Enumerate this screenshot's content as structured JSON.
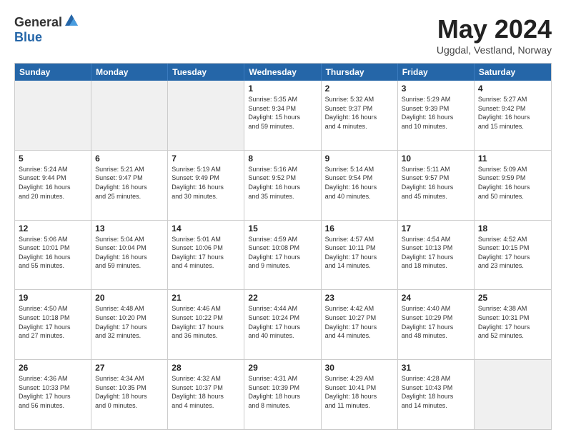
{
  "logo": {
    "general": "General",
    "blue": "Blue"
  },
  "title": "May 2024",
  "subtitle": "Uggdal, Vestland, Norway",
  "days": [
    "Sunday",
    "Monday",
    "Tuesday",
    "Wednesday",
    "Thursday",
    "Friday",
    "Saturday"
  ],
  "rows": [
    [
      {
        "day": "",
        "lines": []
      },
      {
        "day": "",
        "lines": []
      },
      {
        "day": "",
        "lines": []
      },
      {
        "day": "1",
        "lines": [
          "Sunrise: 5:35 AM",
          "Sunset: 9:34 PM",
          "Daylight: 15 hours",
          "and 59 minutes."
        ]
      },
      {
        "day": "2",
        "lines": [
          "Sunrise: 5:32 AM",
          "Sunset: 9:37 PM",
          "Daylight: 16 hours",
          "and 4 minutes."
        ]
      },
      {
        "day": "3",
        "lines": [
          "Sunrise: 5:29 AM",
          "Sunset: 9:39 PM",
          "Daylight: 16 hours",
          "and 10 minutes."
        ]
      },
      {
        "day": "4",
        "lines": [
          "Sunrise: 5:27 AM",
          "Sunset: 9:42 PM",
          "Daylight: 16 hours",
          "and 15 minutes."
        ]
      }
    ],
    [
      {
        "day": "5",
        "lines": [
          "Sunrise: 5:24 AM",
          "Sunset: 9:44 PM",
          "Daylight: 16 hours",
          "and 20 minutes."
        ]
      },
      {
        "day": "6",
        "lines": [
          "Sunrise: 5:21 AM",
          "Sunset: 9:47 PM",
          "Daylight: 16 hours",
          "and 25 minutes."
        ]
      },
      {
        "day": "7",
        "lines": [
          "Sunrise: 5:19 AM",
          "Sunset: 9:49 PM",
          "Daylight: 16 hours",
          "and 30 minutes."
        ]
      },
      {
        "day": "8",
        "lines": [
          "Sunrise: 5:16 AM",
          "Sunset: 9:52 PM",
          "Daylight: 16 hours",
          "and 35 minutes."
        ]
      },
      {
        "day": "9",
        "lines": [
          "Sunrise: 5:14 AM",
          "Sunset: 9:54 PM",
          "Daylight: 16 hours",
          "and 40 minutes."
        ]
      },
      {
        "day": "10",
        "lines": [
          "Sunrise: 5:11 AM",
          "Sunset: 9:57 PM",
          "Daylight: 16 hours",
          "and 45 minutes."
        ]
      },
      {
        "day": "11",
        "lines": [
          "Sunrise: 5:09 AM",
          "Sunset: 9:59 PM",
          "Daylight: 16 hours",
          "and 50 minutes."
        ]
      }
    ],
    [
      {
        "day": "12",
        "lines": [
          "Sunrise: 5:06 AM",
          "Sunset: 10:01 PM",
          "Daylight: 16 hours",
          "and 55 minutes."
        ]
      },
      {
        "day": "13",
        "lines": [
          "Sunrise: 5:04 AM",
          "Sunset: 10:04 PM",
          "Daylight: 16 hours",
          "and 59 minutes."
        ]
      },
      {
        "day": "14",
        "lines": [
          "Sunrise: 5:01 AM",
          "Sunset: 10:06 PM",
          "Daylight: 17 hours",
          "and 4 minutes."
        ]
      },
      {
        "day": "15",
        "lines": [
          "Sunrise: 4:59 AM",
          "Sunset: 10:08 PM",
          "Daylight: 17 hours",
          "and 9 minutes."
        ]
      },
      {
        "day": "16",
        "lines": [
          "Sunrise: 4:57 AM",
          "Sunset: 10:11 PM",
          "Daylight: 17 hours",
          "and 14 minutes."
        ]
      },
      {
        "day": "17",
        "lines": [
          "Sunrise: 4:54 AM",
          "Sunset: 10:13 PM",
          "Daylight: 17 hours",
          "and 18 minutes."
        ]
      },
      {
        "day": "18",
        "lines": [
          "Sunrise: 4:52 AM",
          "Sunset: 10:15 PM",
          "Daylight: 17 hours",
          "and 23 minutes."
        ]
      }
    ],
    [
      {
        "day": "19",
        "lines": [
          "Sunrise: 4:50 AM",
          "Sunset: 10:18 PM",
          "Daylight: 17 hours",
          "and 27 minutes."
        ]
      },
      {
        "day": "20",
        "lines": [
          "Sunrise: 4:48 AM",
          "Sunset: 10:20 PM",
          "Daylight: 17 hours",
          "and 32 minutes."
        ]
      },
      {
        "day": "21",
        "lines": [
          "Sunrise: 4:46 AM",
          "Sunset: 10:22 PM",
          "Daylight: 17 hours",
          "and 36 minutes."
        ]
      },
      {
        "day": "22",
        "lines": [
          "Sunrise: 4:44 AM",
          "Sunset: 10:24 PM",
          "Daylight: 17 hours",
          "and 40 minutes."
        ]
      },
      {
        "day": "23",
        "lines": [
          "Sunrise: 4:42 AM",
          "Sunset: 10:27 PM",
          "Daylight: 17 hours",
          "and 44 minutes."
        ]
      },
      {
        "day": "24",
        "lines": [
          "Sunrise: 4:40 AM",
          "Sunset: 10:29 PM",
          "Daylight: 17 hours",
          "and 48 minutes."
        ]
      },
      {
        "day": "25",
        "lines": [
          "Sunrise: 4:38 AM",
          "Sunset: 10:31 PM",
          "Daylight: 17 hours",
          "and 52 minutes."
        ]
      }
    ],
    [
      {
        "day": "26",
        "lines": [
          "Sunrise: 4:36 AM",
          "Sunset: 10:33 PM",
          "Daylight: 17 hours",
          "and 56 minutes."
        ]
      },
      {
        "day": "27",
        "lines": [
          "Sunrise: 4:34 AM",
          "Sunset: 10:35 PM",
          "Daylight: 18 hours",
          "and 0 minutes."
        ]
      },
      {
        "day": "28",
        "lines": [
          "Sunrise: 4:32 AM",
          "Sunset: 10:37 PM",
          "Daylight: 18 hours",
          "and 4 minutes."
        ]
      },
      {
        "day": "29",
        "lines": [
          "Sunrise: 4:31 AM",
          "Sunset: 10:39 PM",
          "Daylight: 18 hours",
          "and 8 minutes."
        ]
      },
      {
        "day": "30",
        "lines": [
          "Sunrise: 4:29 AM",
          "Sunset: 10:41 PM",
          "Daylight: 18 hours",
          "and 11 minutes."
        ]
      },
      {
        "day": "31",
        "lines": [
          "Sunrise: 4:28 AM",
          "Sunset: 10:43 PM",
          "Daylight: 18 hours",
          "and 14 minutes."
        ]
      },
      {
        "day": "",
        "lines": []
      }
    ]
  ]
}
